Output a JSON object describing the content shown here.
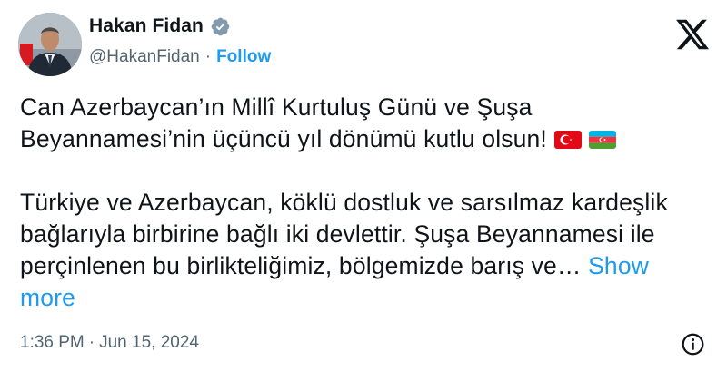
{
  "author": {
    "name": "Hakan Fidan",
    "handle": "@HakanFidan",
    "separator": "·",
    "follow_label": "Follow"
  },
  "tweet": {
    "paragraph1": "Can Azerbaycan’ın Millî Kurtuluş Günü ve Şuşa Beyannamesi’nin üçüncü yıl dönümü kutlu olsun!",
    "paragraph2": "Türkiye ve Azerbaycan, köklü dostluk ve sarsılmaz kardeşlik bağlarıyla birbirine bağlı iki devlettir. Şuşa Beyannamesi ile perçinlenen bu birlikteliğimiz, bölgemizde barış ve…",
    "show_more_label": "Show more",
    "flags": [
      "turkey-flag-icon",
      "azerbaijan-flag-icon"
    ]
  },
  "meta": {
    "time": "1:36 PM",
    "separator": "·",
    "date": "Jun 15, 2024"
  },
  "icons": {
    "verified": "verified-badge-icon",
    "logo": "x-logo-icon",
    "info": "info-icon"
  },
  "colors": {
    "accent": "#1d9bf0",
    "text": "#0f1419",
    "secondary": "#536471",
    "verified_badge": "#829aab",
    "turkey_red": "#e30a17",
    "azerbaijan_blue": "#00b5e2",
    "azerbaijan_red": "#ef3340",
    "azerbaijan_green": "#509e2f"
  }
}
